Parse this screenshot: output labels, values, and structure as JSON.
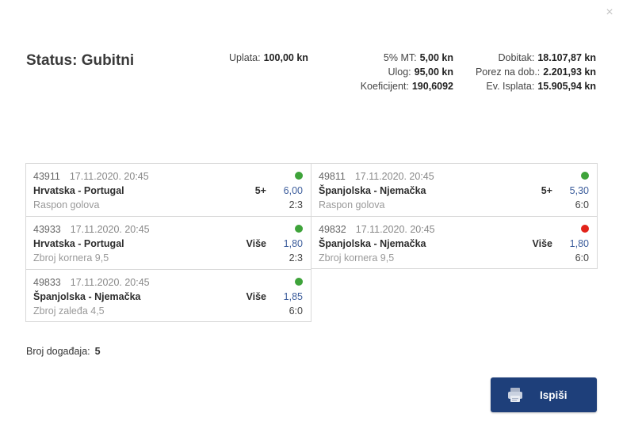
{
  "close_symbol": "×",
  "status": {
    "label": "Status:",
    "value": "Gubitni"
  },
  "summary": {
    "uplata": {
      "label": "Uplata:",
      "value": "100,00 kn"
    },
    "mt": {
      "label": "5% MT:",
      "value": "5,00 kn"
    },
    "ulog": {
      "label": "Ulog:",
      "value": "95,00 kn"
    },
    "koeficijent": {
      "label": "Koeficijent:",
      "value": "190,6092"
    },
    "dobitak": {
      "label": "Dobitak:",
      "value": "18.107,87 kn"
    },
    "porez": {
      "label": "Porez na dob.:",
      "value": "2.201,93 kn"
    },
    "isplata": {
      "label": "Ev. Isplata:",
      "value": "15.905,94 kn"
    }
  },
  "events": [
    {
      "code": "43911",
      "datetime": "17.11.2020. 20:45",
      "match": "Hrvatska - Portugal",
      "market": "Raspon golova",
      "tip": "5+",
      "odd": "6,00",
      "result": "2:3",
      "status": "win"
    },
    {
      "code": "49811",
      "datetime": "17.11.2020. 20:45",
      "match": "Španjolska - Njemačka",
      "market": "Raspon golova",
      "tip": "5+",
      "odd": "5,30",
      "result": "6:0",
      "status": "win"
    },
    {
      "code": "43933",
      "datetime": "17.11.2020. 20:45",
      "match": "Hrvatska - Portugal",
      "market": "Zbroj kornera 9,5",
      "tip": "Više",
      "odd": "1,80",
      "result": "2:3",
      "status": "win"
    },
    {
      "code": "49832",
      "datetime": "17.11.2020. 20:45",
      "match": "Španjolska - Njemačka",
      "market": "Zbroj kornera 9,5",
      "tip": "Više",
      "odd": "1,80",
      "result": "6:0",
      "status": "lose"
    },
    {
      "code": "49833",
      "datetime": "17.11.2020. 20:45",
      "match": "Španjolska - Njemačka",
      "market": "Zbroj zaleđa 4,5",
      "tip": "Više",
      "odd": "1,85",
      "result": "6:0",
      "status": "win"
    }
  ],
  "event_count": {
    "label": "Broj događaja:",
    "value": "5"
  },
  "print_button": {
    "label": "Ispiši",
    "icon": "printer-icon"
  },
  "colors": {
    "accent": "#1e3f7a",
    "odd_text": "#3c5d9c",
    "status_win": "#3ea33a",
    "status_lose": "#e2231a"
  }
}
